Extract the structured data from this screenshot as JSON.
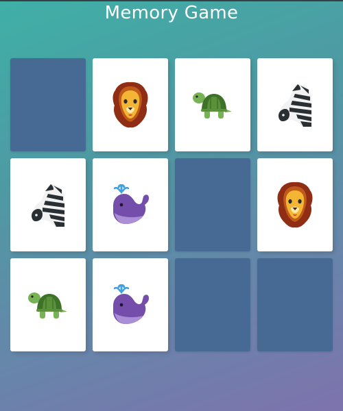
{
  "title": "Memory Game",
  "colors": {
    "face_down": "#466a93",
    "face_up": "#ffffff",
    "title_text": "#ffffff"
  },
  "cards": [
    {
      "state": "face-down",
      "icon": null
    },
    {
      "state": "face-up",
      "icon": "lion-icon"
    },
    {
      "state": "face-up",
      "icon": "turtle-icon"
    },
    {
      "state": "face-up",
      "icon": "zebra-icon"
    },
    {
      "state": "face-up",
      "icon": "zebra-icon"
    },
    {
      "state": "face-up",
      "icon": "whale-icon"
    },
    {
      "state": "face-down",
      "icon": null
    },
    {
      "state": "face-up",
      "icon": "lion-icon"
    },
    {
      "state": "face-up",
      "icon": "turtle-icon"
    },
    {
      "state": "face-up",
      "icon": "whale-icon"
    },
    {
      "state": "face-down",
      "icon": null
    },
    {
      "state": "face-down",
      "icon": null
    }
  ]
}
